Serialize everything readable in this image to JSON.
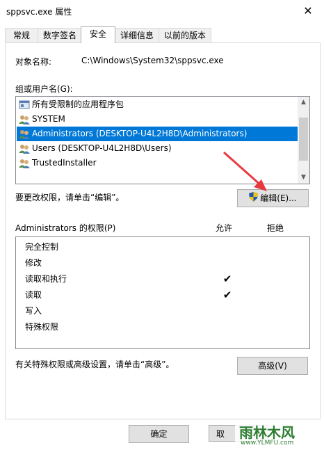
{
  "window": {
    "title": "sppsvc.exe 属性",
    "close_glyph": "✕"
  },
  "tabs": [
    {
      "label": "常规"
    },
    {
      "label": "数字签名"
    },
    {
      "label": "安全"
    },
    {
      "label": "详细信息"
    },
    {
      "label": "以前的版本"
    }
  ],
  "active_tab": "安全",
  "object_name": {
    "label": "对象名称:",
    "value": "C:\\Windows\\System32\\sppsvc.exe"
  },
  "groups": {
    "label": "组或用户名(G):",
    "items": [
      {
        "label": "所有受限制的应用程序包",
        "icon": "app-package-icon",
        "selected": false
      },
      {
        "label": "SYSTEM",
        "icon": "users-icon",
        "selected": false
      },
      {
        "label": "Administrators (DESKTOP-U4L2H8D\\Administrators)",
        "icon": "users-icon",
        "selected": true
      },
      {
        "label": "Users (DESKTOP-U4L2H8D\\Users)",
        "icon": "users-icon",
        "selected": false
      },
      {
        "label": "TrustedInstaller",
        "icon": "users-icon",
        "selected": false
      }
    ]
  },
  "edit_hint": "要更改权限，请单击“编辑”。",
  "edit_button": "编辑(E)...",
  "permissions": {
    "header": "Administrators 的权限(P)",
    "allow_header": "允许",
    "deny_header": "拒绝",
    "rows": [
      {
        "label": "完全控制",
        "allow": false,
        "deny": false
      },
      {
        "label": "修改",
        "allow": false,
        "deny": false
      },
      {
        "label": "读取和执行",
        "allow": true,
        "deny": false
      },
      {
        "label": "读取",
        "allow": true,
        "deny": false
      },
      {
        "label": "写入",
        "allow": false,
        "deny": false
      },
      {
        "label": "特殊权限",
        "allow": false,
        "deny": false
      }
    ],
    "check_glyph": "✔"
  },
  "advanced_hint": "有关特殊权限或高级设置，请单击“高级”。",
  "advanced_button": "高级(V)",
  "ok_button": "确定",
  "cancel_button": "取",
  "watermark": {
    "text": "雨林木风",
    "url": "www.YLMFU.com"
  },
  "colors": {
    "selection": "#0078d7",
    "arrow": "#e8393f",
    "button_bg": "#e1e1e1"
  }
}
